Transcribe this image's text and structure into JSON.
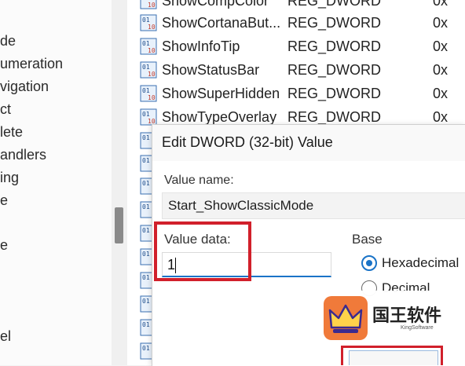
{
  "tree": {
    "items": [
      "de",
      "umeration",
      "vigation",
      "ct",
      "lete",
      "andlers",
      "ing",
      "e",
      "e",
      "el"
    ]
  },
  "values": {
    "rows": [
      {
        "name": "ShowCompColor",
        "type": "REG_DWORD",
        "data": "0x"
      },
      {
        "name": "ShowCortanaBut...",
        "type": "REG_DWORD",
        "data": "0x"
      },
      {
        "name": "ShowInfoTip",
        "type": "REG_DWORD",
        "data": "0x"
      },
      {
        "name": "ShowStatusBar",
        "type": "REG_DWORD",
        "data": "0x"
      },
      {
        "name": "ShowSuperHidden",
        "type": "REG_DWORD",
        "data": "0x"
      },
      {
        "name": "ShowTypeOverlay",
        "type": "REG_DWORD",
        "data": "0x"
      }
    ]
  },
  "dialog": {
    "title": "Edit DWORD (32-bit) Value",
    "value_name_label": "Value name:",
    "value_name": "Start_ShowClassicMode",
    "value_data_label": "Value data:",
    "value_data": "1",
    "base_label": "Base",
    "base_options": [
      "Hexadecimal",
      "Decimal"
    ],
    "base_selected": "Hexadecimal",
    "highlight_color": "#d1202b"
  },
  "watermark": {
    "title": "国王软件",
    "subtitle": "KingSoftware",
    "logo_color": "#f07a3a"
  }
}
